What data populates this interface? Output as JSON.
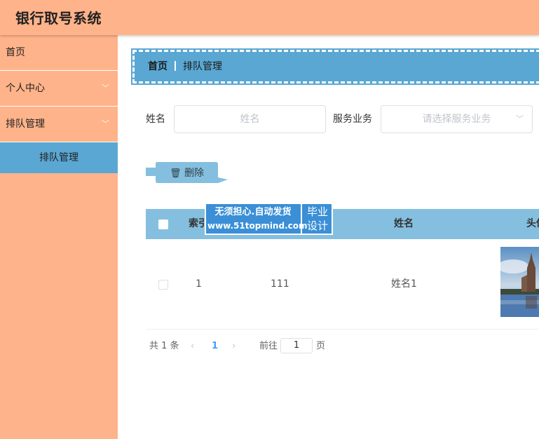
{
  "header": {
    "title": "银行取号系统"
  },
  "sidebar": {
    "items": [
      {
        "label": "首页"
      },
      {
        "label": "个人中心"
      },
      {
        "label": "排队管理"
      }
    ],
    "sub_item": "排队管理"
  },
  "breadcrumb": {
    "home": "首页",
    "current": "排队管理"
  },
  "search": {
    "name_label": "姓名",
    "name_placeholder": "姓名",
    "service_label": "服务业务",
    "service_placeholder": "请选择服务业务"
  },
  "toolbar": {
    "delete_label": "删除"
  },
  "table": {
    "headers": [
      "索引",
      "姓名",
      "头像"
    ],
    "rows": [
      {
        "index": "1",
        "code": "111",
        "name": "姓名1"
      }
    ]
  },
  "pagination": {
    "total_text": "共 1 条",
    "current_page": "1",
    "goto_prefix": "前往",
    "goto_value": "1",
    "goto_suffix": "页"
  },
  "watermark": {
    "line1": "无须担心.自动发货",
    "line2": "www.51topmind.com",
    "right1": "毕业",
    "right2": "设计"
  },
  "colors": {
    "accent_orange": "#ffb38a",
    "accent_blue": "#5aa7d3",
    "table_head": "#85bfdf"
  }
}
